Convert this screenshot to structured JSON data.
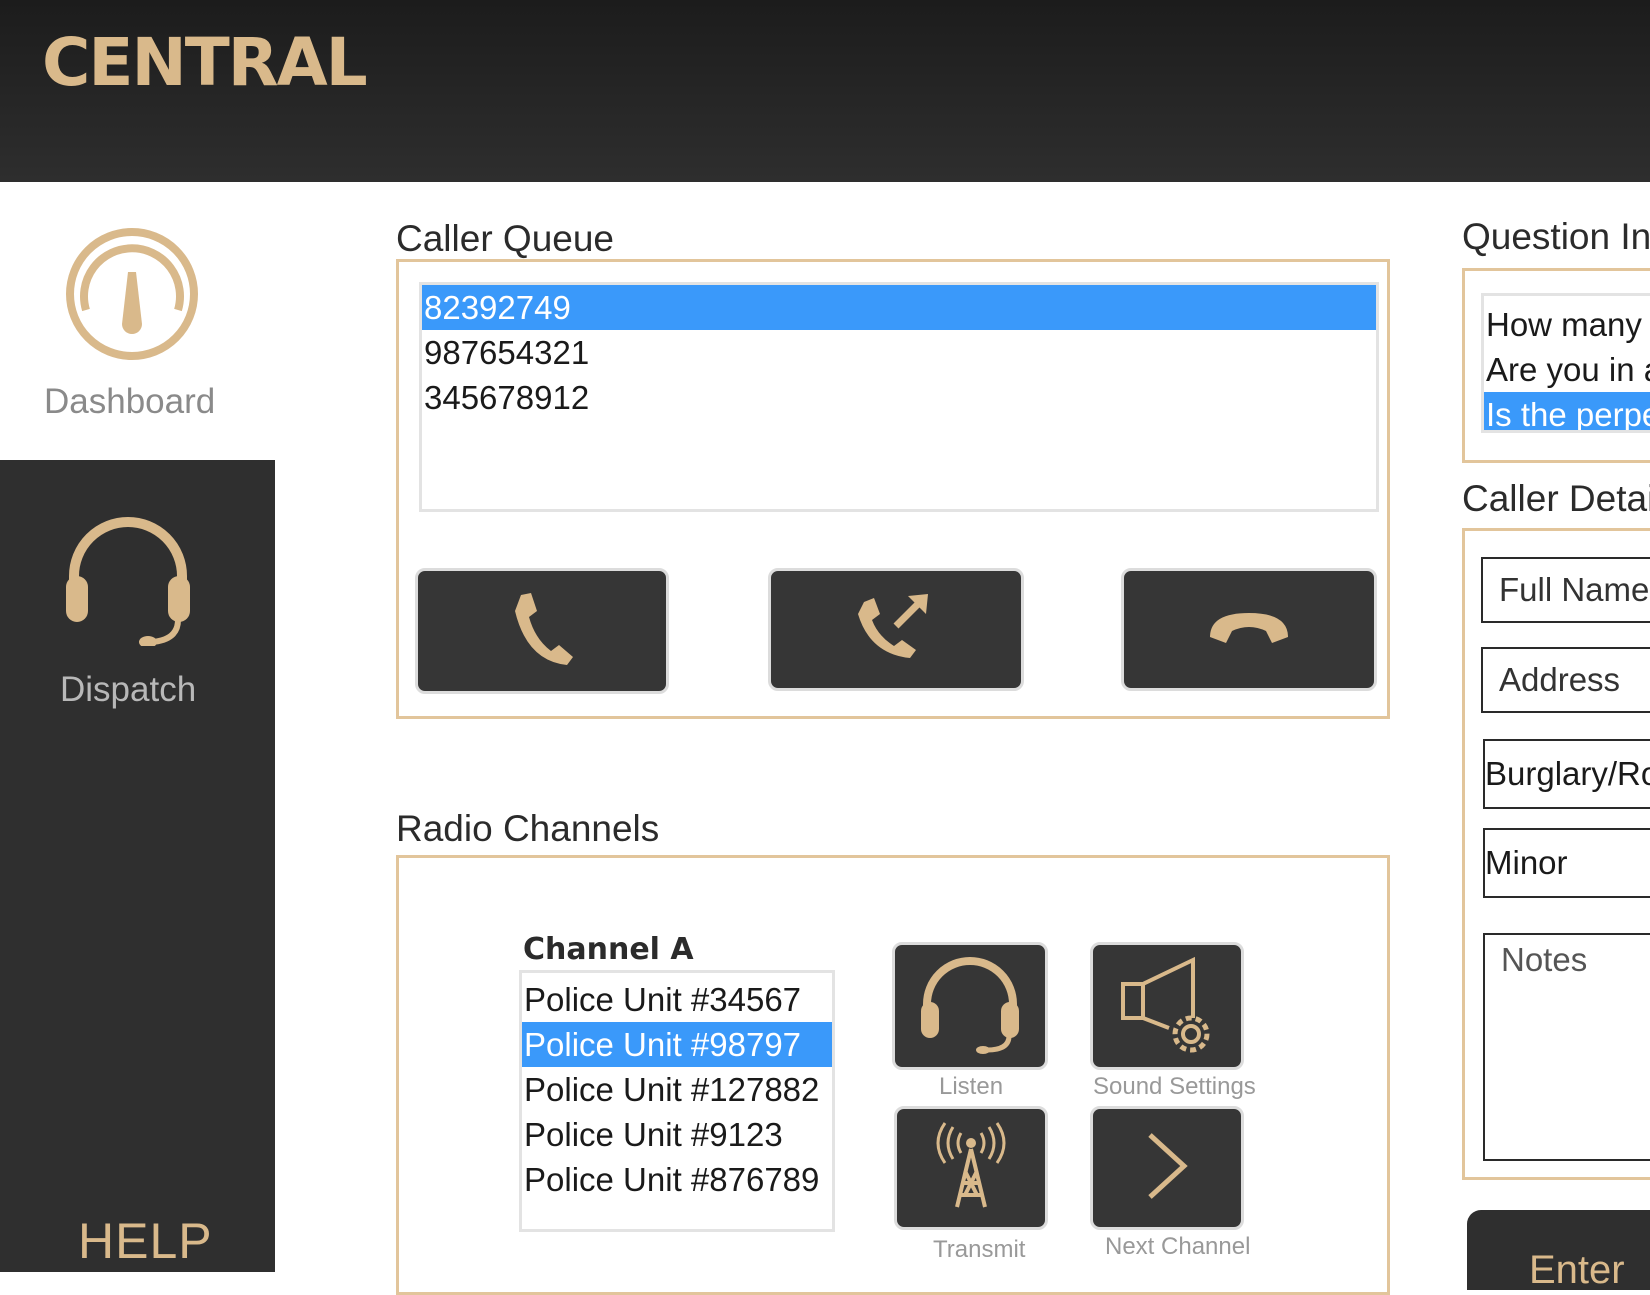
{
  "app": {
    "brand": "CENTRAL"
  },
  "sidebar": {
    "dashboard_label": "Dashboard",
    "dispatch_label": "Dispatch",
    "help_label": "HELP"
  },
  "caller_queue": {
    "title": "Caller Queue",
    "items": [
      "82392749",
      "987654321",
      "345678912"
    ],
    "selected": "82392749"
  },
  "question_inventory": {
    "title": "Question Inv",
    "items": [
      "How many p",
      "Are you in a",
      "Is the perpe"
    ],
    "selected": "Is the perpe"
  },
  "caller_details": {
    "title": "Caller Detail",
    "full_name_placeholder": "Full Name",
    "address_placeholder": "Address",
    "incident_type": "Burglary/Ro",
    "severity": "Minor",
    "notes_placeholder": "Notes"
  },
  "radio_channels": {
    "title": "Radio Channels",
    "channel_name": "Channel A",
    "units": [
      "Police Unit #34567",
      "Police Unit #98797",
      "Police Unit #127882",
      "Police Unit #9123",
      "Police Unit #876789"
    ],
    "selected": "Police Unit #98797",
    "listen_label": "Listen",
    "sound_settings_label": "Sound Settings",
    "transmit_label": "Transmit",
    "next_channel_label": "Next Channel"
  },
  "enter_button": {
    "label": "Enter"
  },
  "colors": {
    "accent": "#d9b98b",
    "selection": "#3a99fa",
    "dark": "#2f2f2f"
  }
}
